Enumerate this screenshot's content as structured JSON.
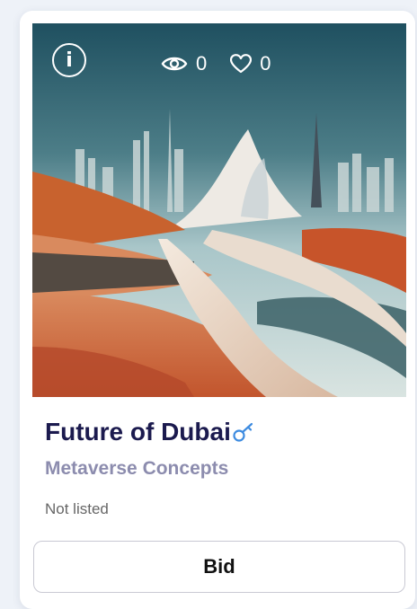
{
  "card": {
    "title": "Future of Dubai",
    "collection": "Metaverse Concepts",
    "status": "Not listed",
    "bid_label": "Bid",
    "info_icon_glyph": "i",
    "views": "0",
    "likes": "0",
    "icons": {
      "info": "info-icon",
      "views": "eye-icon",
      "likes": "heart-icon",
      "title_badge": "key-icon"
    },
    "colors": {
      "title": "#1b1a4e",
      "collection": "#8c8cae",
      "badge": "#3d8be0"
    }
  }
}
